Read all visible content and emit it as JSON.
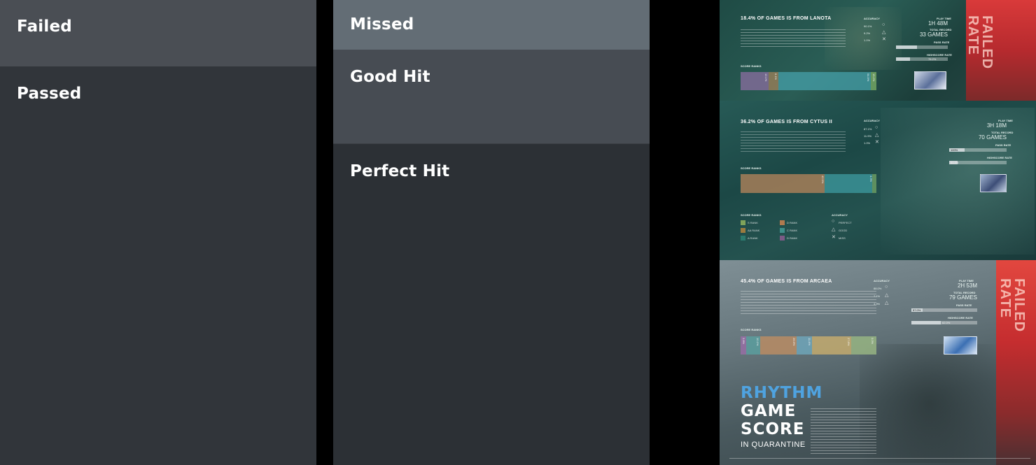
{
  "column_one": {
    "panels": [
      {
        "label": "Failed",
        "color": "#4a4e54"
      },
      {
        "label": "Passed",
        "color": "#31353a"
      }
    ]
  },
  "column_two": {
    "panels": [
      {
        "label": "Missed",
        "color": "#636d75"
      },
      {
        "label": "Good Hit",
        "color": "#474c53"
      },
      {
        "label": "Perfect Hit",
        "color": "#2c3035"
      }
    ]
  },
  "poster": {
    "sections": [
      {
        "title": "18.4% OF GAMES IS FROM LANOTA",
        "accuracy_label": "ACCURACY",
        "accuracy_values": [
          "90.1%",
          "9.2%",
          "1.1%"
        ],
        "play_time_label": "PLAY TIME",
        "play_time": "1H 48M",
        "total_record_label": "TOTAL RECORD",
        "total_record": "33 GAMES",
        "pass_rate_label": "PASS RATE",
        "pass_rate": "",
        "highscore_rate_label": "HIGHSCORE RATE",
        "highscore_rate": "76.2%",
        "score_ranks_label": "SCORE RANKS",
        "rank_values": [
          "12.1%",
          "6.1%",
          "54.5%",
          "15.2%"
        ],
        "failed_rate": "FAILED RATE"
      },
      {
        "title": "36.2% OF GAMES IS FROM CYTUS II",
        "accuracy_label": "ACCURACY",
        "accuracy_values": [
          "87.1%",
          "11.9%",
          "1.0%"
        ],
        "play_time_label": "PLAY TIME",
        "play_time": "3H 18M",
        "total_record_label": "TOTAL RECORD",
        "total_record": "70 GAMES",
        "pass_rate_label": "PASS RATE",
        "pass_rate": "100%",
        "highscore_rate_label": "HIGHSCORE RATE",
        "highscore_rate": "51.4%",
        "score_ranks_label": "SCORE RANKS",
        "rank_values": [
          "",
          "42.9%",
          "4.3%"
        ],
        "legend_title": "SCORE RANKS",
        "legend_items": [
          {
            "label": "S RANK",
            "color": "#7fa35a"
          },
          {
            "label": "D RANK",
            "color": "#b07a4f"
          },
          {
            "label": "AA RANK",
            "color": "#9b7b3f"
          },
          {
            "label": "C RANK",
            "color": "#3f8f8a"
          },
          {
            "label": "A RANK",
            "color": "#2b7a6e"
          },
          {
            "label": "D RANK",
            "color": "#7b5b86"
          }
        ],
        "legend_accuracy_title": "ACCURACY",
        "legend_accuracy_items": [
          "PERFECT",
          "GOOD",
          "MISS"
        ]
      },
      {
        "title": "45.4% OF GAMES IS FROM ARCAEA",
        "accuracy_label": "ACCURACY",
        "accuracy_values": [
          "88.0%",
          "7.1%",
          "4.9%"
        ],
        "play_time_label": "PLAY TIME",
        "play_time": "2H 53M",
        "total_record_label": "TOTAL RECORD",
        "total_record": "79 GAMES",
        "pass_rate_label": "PASS RATE",
        "pass_rate": "57.0%",
        "highscore_rate_label": "HIGHSCORE RATE",
        "highscore_rate": "62.0%",
        "score_ranks_label": "SCORE RANKS",
        "rank_values": [
          "3.8%",
          "10.1%",
          "26.6%",
          "11.4%",
          "27.8%",
          "0.0%"
        ],
        "failed_rate": "FAILED RATE"
      }
    ],
    "headline": [
      "RHYTHM",
      "GAME",
      "SCORE"
    ],
    "subheadline": "IN QUARANTINE"
  }
}
